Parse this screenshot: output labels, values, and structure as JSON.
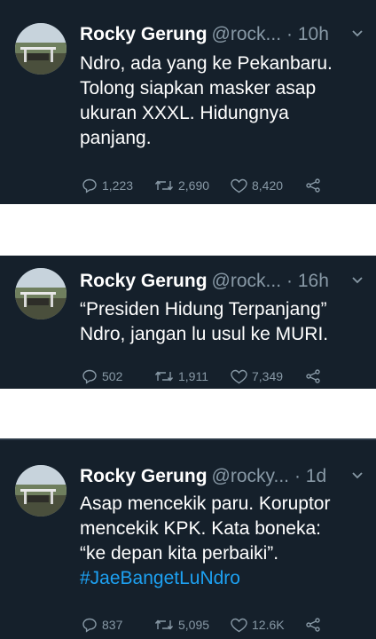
{
  "tweets": [
    {
      "name": "Rocky Gerung",
      "handle": "@rock...",
      "time": "· 10h",
      "lines": [
        "Ndro, ada yang ke Pekanbaru.",
        "Tolong siapkan masker asap",
        "ukuran XXXL. Hidungnya",
        "panjang."
      ],
      "replies": "1,223",
      "retweets": "2,690",
      "likes": "8,420"
    },
    {
      "name": "Rocky Gerung",
      "handle": "@rock...",
      "time": "· 16h",
      "lines": [
        "“Presiden Hidung Terpanjang”",
        "Ndro, jangan lu usul ke MURI."
      ],
      "replies": "502",
      "retweets": "1,911",
      "likes": "7,349"
    },
    {
      "name": "Rocky Gerung",
      "handle": "@rocky...",
      "time": "· 1d",
      "lines": [
        "Asap mencekik paru. Koruptor",
        "mencekik KPK. Kata boneka:",
        "“ke depan kita perbaiki”."
      ],
      "hashtag": "#JaeBangetLuNdro",
      "replies": "837",
      "retweets": "5,095",
      "likes": "12.6K"
    }
  ],
  "colors": {
    "background": "#15202b",
    "secondary_text": "#8899a6",
    "hashtag": "#1da1f2",
    "gap": "#ffffff"
  },
  "icons": [
    "avatar-photo",
    "chevron-down-icon",
    "reply-icon",
    "retweet-icon",
    "like-icon",
    "share-icon"
  ]
}
